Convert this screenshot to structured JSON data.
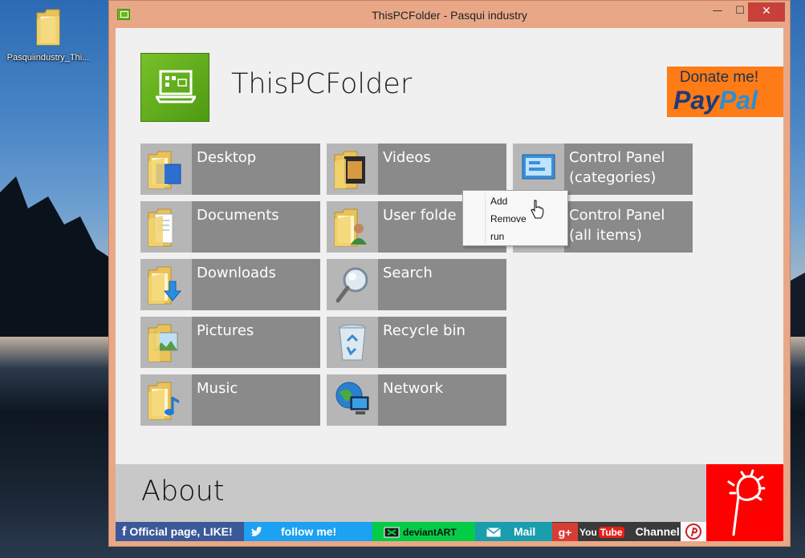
{
  "desktop": {
    "icon_label": "Pasquiindustry_Thi..."
  },
  "window": {
    "title": "ThisPCFolder - Pasqui industry",
    "min_glyph": "—",
    "max_glyph": "☐",
    "close_glyph": "✕"
  },
  "app": {
    "heading": "ThisPCFolder",
    "donate_top": "Donate me!",
    "donate_pay": "Pay",
    "donate_pal": "Pal"
  },
  "tiles": [
    {
      "label": "Desktop",
      "icon": "folder-desktop-icon"
    },
    {
      "label": "Documents",
      "icon": "folder-documents-icon"
    },
    {
      "label": "Downloads",
      "icon": "folder-downloads-icon"
    },
    {
      "label": "Pictures",
      "icon": "folder-pictures-icon"
    },
    {
      "label": "Music",
      "icon": "folder-music-icon"
    },
    {
      "label": "Videos",
      "icon": "folder-videos-icon"
    },
    {
      "label": "User folde",
      "icon": "folder-user-icon"
    },
    {
      "label": "Search",
      "icon": "magnifier-icon"
    },
    {
      "label": "Recycle bin",
      "icon": "recycle-bin-icon"
    },
    {
      "label": "Network",
      "icon": "network-globe-icon"
    },
    {
      "label": "Control Panel\n(categories)",
      "label_line1": "Control Panel",
      "label_line2": "(categories)",
      "icon": "control-panel-icon"
    },
    {
      "label": "Control Panel\n(all items)",
      "label_line1": "Control Panel",
      "label_line2": "(all items)",
      "icon": "control-panel-icon"
    }
  ],
  "context_menu": {
    "items": [
      "Add",
      "Remove",
      "run"
    ]
  },
  "about": {
    "title": "About",
    "social": {
      "facebook": "Official page, LIKE!",
      "twitter": "follow me!",
      "deviantart": "deviantART",
      "mail": "Mail",
      "youtube_you": "You",
      "youtube_tube": "Tube",
      "youtube_channel": "Channel"
    }
  },
  "colors": {
    "title_bar": "#e8a888",
    "tile_bg": "#8a8a8a",
    "tile_icon_bg": "#b6b6b6",
    "donate_bg": "#ff7b16",
    "brand_red": "#ff0000",
    "logo_green": "#6fb51f"
  }
}
